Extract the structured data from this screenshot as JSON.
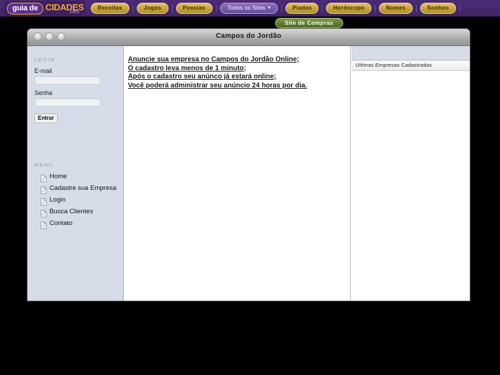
{
  "topbar": {
    "logo": {
      "pill_text": "guia de",
      "word": "CIDADES",
      "tld": ".com"
    },
    "nav_items": [
      {
        "label": "Receitas",
        "style": "gold",
        "caret": false
      },
      {
        "label": "Jogos",
        "style": "gold",
        "caret": false
      },
      {
        "label": "Poesias",
        "style": "gold",
        "caret": false
      },
      {
        "label": "Todos os Sites",
        "style": "purple",
        "caret": true
      },
      {
        "label": "Piadas",
        "style": "gold",
        "caret": false
      },
      {
        "label": "Horóscopo",
        "style": "gold",
        "caret": false
      },
      {
        "label": "Nomes",
        "style": "gold",
        "caret": false
      },
      {
        "label": "Sonhos",
        "style": "gold",
        "caret": false
      }
    ],
    "caret_glyph": "▾",
    "secondary_button": "Site de Compras",
    "colors": {
      "bar_purple": "#46296f",
      "gold_button": "#c9a437",
      "purple_button": "#7a5bae",
      "green_button": "#5f7c2e",
      "logo_orange": "#f5a81c"
    }
  },
  "window": {
    "title": "Campos do Jordão",
    "traffic_lights": [
      "close-button",
      "minimize-button",
      "zoom-button"
    ]
  },
  "sidebar": {
    "login_section_label": "LOGIN",
    "email_label": "E-mail",
    "email_value": "",
    "email_placeholder": "",
    "senha_label": "Senha",
    "senha_value": "",
    "senha_placeholder": "",
    "submit_label": "Entrar",
    "menu_section_label": "MENU",
    "menu_items": [
      {
        "label": "Home"
      },
      {
        "label": "Cadastre sua Empresa"
      },
      {
        "label": "Login"
      },
      {
        "label": "Busca Clientes"
      },
      {
        "label": "Contato"
      }
    ]
  },
  "main": {
    "promo_lines": [
      "Anuncie sua empresa no Campos do Jordão Online;",
      "O cadastro leva menos de 1 minuto;",
      "Após o cadastro seu anúnco já estará online;",
      "Você poderá administrar seu anúncio 24 horas por dia."
    ]
  },
  "right_column": {
    "title": "Ultimas Empresas Cadastradas",
    "entries": []
  }
}
